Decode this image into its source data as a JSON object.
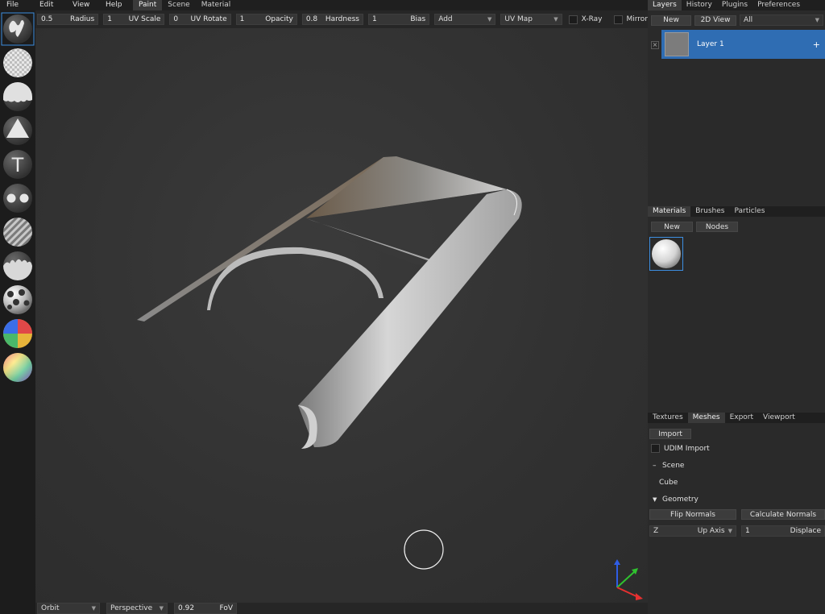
{
  "menu": {
    "items": [
      "File",
      "Edit",
      "View",
      "Help"
    ],
    "workspace_tabs": [
      "Paint",
      "Scene",
      "Material"
    ],
    "active_workspace": "Paint"
  },
  "tool_options": {
    "radius": {
      "value": "0.5",
      "label": "Radius"
    },
    "uv_scale": {
      "value": "1",
      "label": "UV Scale"
    },
    "uv_rotate": {
      "value": "0",
      "label": "UV Rotate"
    },
    "opacity": {
      "value": "1",
      "label": "Opacity"
    },
    "hardness": {
      "value": "0.8",
      "label": "Hardness"
    },
    "bias": {
      "value": "1",
      "label": "Bias"
    },
    "blending": "Add",
    "mapping": "UV Map",
    "xray_label": "X-Ray",
    "mirror_label": "Mirror"
  },
  "left_tools": [
    "brush-tool",
    "eraser-tool",
    "fill-tool",
    "decal-tool",
    "text-tool",
    "clone-tool",
    "blur-tool",
    "particle-tool",
    "bake-tool",
    "colorid-tool",
    "picker-tool"
  ],
  "layers_panel": {
    "tabs": [
      "Layers",
      "History",
      "Plugins",
      "Preferences"
    ],
    "new_label": "New",
    "view2d_label": "2D View",
    "filter": "All",
    "layer_name": "Layer 1",
    "add_label": "+"
  },
  "materials_panel": {
    "tabs": [
      "Materials",
      "Brushes",
      "Particles"
    ],
    "new_label": "New",
    "nodes_label": "Nodes"
  },
  "meshes_panel": {
    "tabs": [
      "Textures",
      "Meshes",
      "Export",
      "Viewport"
    ],
    "import_label": "Import",
    "udim_label": "UDIM Import",
    "scene_label": "Scene",
    "scene_toggle": "–",
    "cube_label": "Cube",
    "geometry_label": "Geometry",
    "geometry_toggle": "▼",
    "flip_normals_label": "Flip Normals",
    "calc_normals_label": "Calculate Normals",
    "up_axis_value": "Z",
    "up_axis_label": "Up Axis",
    "displace_value": "1",
    "displace_label": "Displace"
  },
  "status": {
    "camera_mode": "Orbit",
    "projection": "Perspective",
    "fov_value": "0.92",
    "fov_label": "FoV"
  },
  "colors": {
    "accent": "#3d8ee0",
    "selected_layer": "#2f6db3",
    "axis_x": "#e53030",
    "axis_y": "#2fc22f",
    "axis_z": "#2f5de5"
  }
}
